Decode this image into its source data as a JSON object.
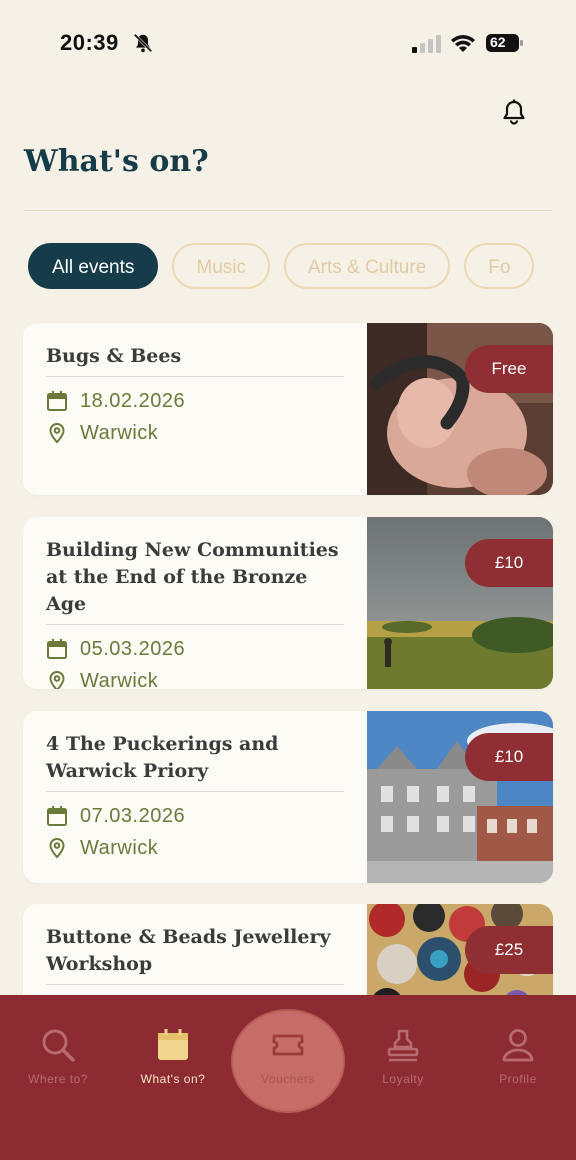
{
  "status_bar": {
    "time": "20:39",
    "battery": "62"
  },
  "header": {
    "title": "What's on?",
    "notification_icon": "bell-icon"
  },
  "filters": [
    {
      "label": "All events",
      "active": true
    },
    {
      "label": "Music",
      "active": false
    },
    {
      "label": "Arts & Culture",
      "active": false
    },
    {
      "label": "Fo",
      "active": false
    }
  ],
  "events": [
    {
      "title": "Bugs & Bees",
      "date": "18.02.2026",
      "location": "Warwick",
      "price": "Free",
      "image": "millipede-in-hand"
    },
    {
      "title": "Building New Communities at the End of the Bronze Age",
      "date": "05.03.2026",
      "location": "Warwick",
      "price": "£10",
      "image": "field-landscape"
    },
    {
      "title": "4 The Puckerings and Warwick Priory",
      "date": "07.03.2026",
      "location": "Warwick",
      "price": "£10",
      "image": "priory-building"
    },
    {
      "title": "Buttone & Beads Jewellery Workshop",
      "date": "",
      "location": "",
      "price": "£25",
      "image": "buttons-beads"
    }
  ],
  "tabs": [
    {
      "label": "Where to?",
      "icon": "search-icon",
      "active": false
    },
    {
      "label": "What's on?",
      "icon": "calendar-icon",
      "active": true
    },
    {
      "label": "Vouchers",
      "icon": "ticket-icon",
      "active": false
    },
    {
      "label": "Loyalty",
      "icon": "stamp-icon",
      "active": false
    },
    {
      "label": "Profile",
      "icon": "user-icon",
      "active": false
    }
  ],
  "colors": {
    "primary": "#163c4a",
    "accent": "#8f2e33",
    "background": "#f5f1e6",
    "meta_text": "#6b7a3a"
  }
}
